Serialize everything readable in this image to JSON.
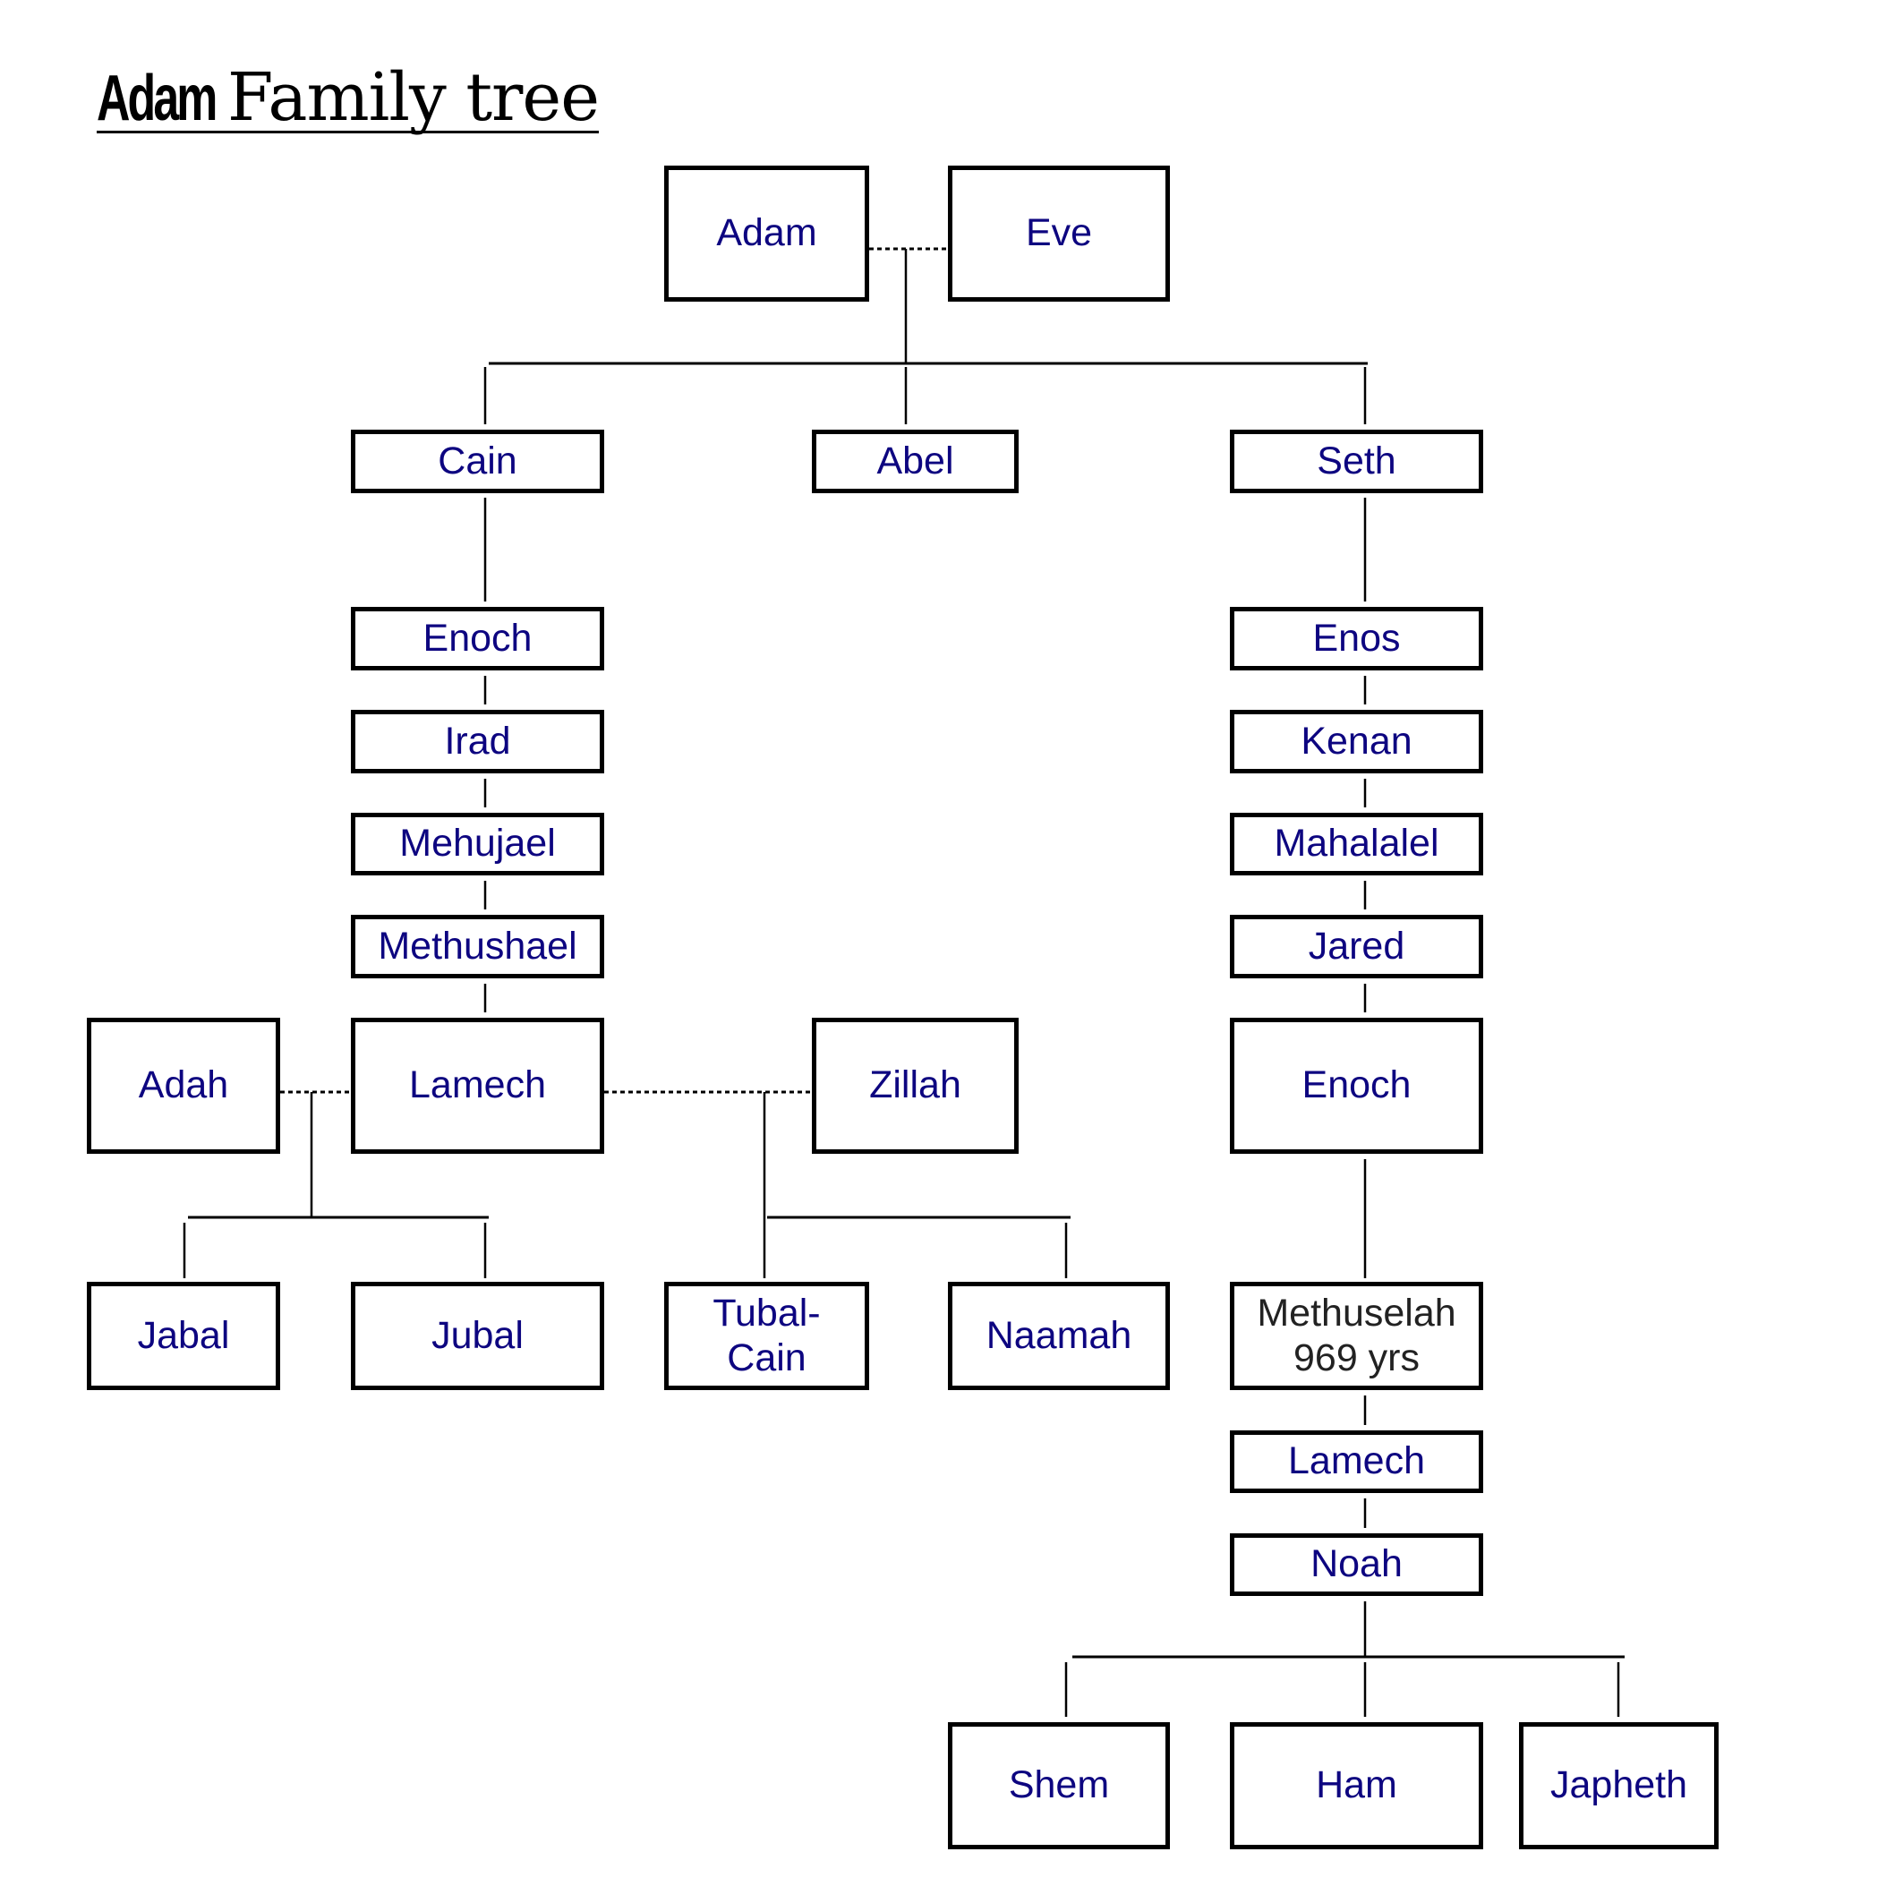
{
  "title": {
    "part1": "Adam",
    "part2": "Family tree"
  },
  "colors": {
    "name_text": "#0d0580",
    "highlight_text": "#222222",
    "border": "#000000"
  },
  "nodes": {
    "adam": "Adam",
    "eve": "Eve",
    "cain": "Cain",
    "abel": "Abel",
    "seth": "Seth",
    "enoch_cain": "Enoch",
    "irad": "Irad",
    "mehujael": "Mehujael",
    "methushael": "Methushael",
    "adah": "Adah",
    "lamech_cain": "Lamech",
    "zillah": "Zillah",
    "jabal": "Jabal",
    "jubal": "Jubal",
    "tubal_cain": "Tubal-\nCain",
    "naamah": "Naamah",
    "enos": "Enos",
    "kenan": "Kenan",
    "mahalalel": "Mahalalel",
    "jared": "Jared",
    "enoch_seth": "Enoch",
    "methuselah": "Methuselah\n969 yrs",
    "lamech_seth": "Lamech",
    "noah": "Noah",
    "shem": "Shem",
    "ham": "Ham",
    "japheth": "Japheth"
  },
  "relations": {
    "marriages": [
      [
        "adam",
        "eve"
      ],
      [
        "adah",
        "lamech_cain"
      ],
      [
        "lamech_cain",
        "zillah"
      ]
    ],
    "children": {
      "adam+eve": [
        "cain",
        "abel",
        "seth"
      ],
      "cain": [
        "enoch_cain"
      ],
      "enoch_cain": [
        "irad"
      ],
      "irad": [
        "mehujael"
      ],
      "mehujael": [
        "methushael"
      ],
      "methushael": [
        "lamech_cain"
      ],
      "adah+lamech_cain": [
        "jabal",
        "jubal"
      ],
      "lamech_cain+zillah": [
        "tubal_cain",
        "naamah"
      ],
      "seth": [
        "enos"
      ],
      "enos": [
        "kenan"
      ],
      "kenan": [
        "mahalalel"
      ],
      "mahalalel": [
        "jared"
      ],
      "jared": [
        "enoch_seth"
      ],
      "enoch_seth": [
        "methuselah"
      ],
      "methuselah": [
        "lamech_seth"
      ],
      "lamech_seth": [
        "noah"
      ],
      "noah": [
        "shem",
        "ham",
        "japheth"
      ]
    }
  }
}
